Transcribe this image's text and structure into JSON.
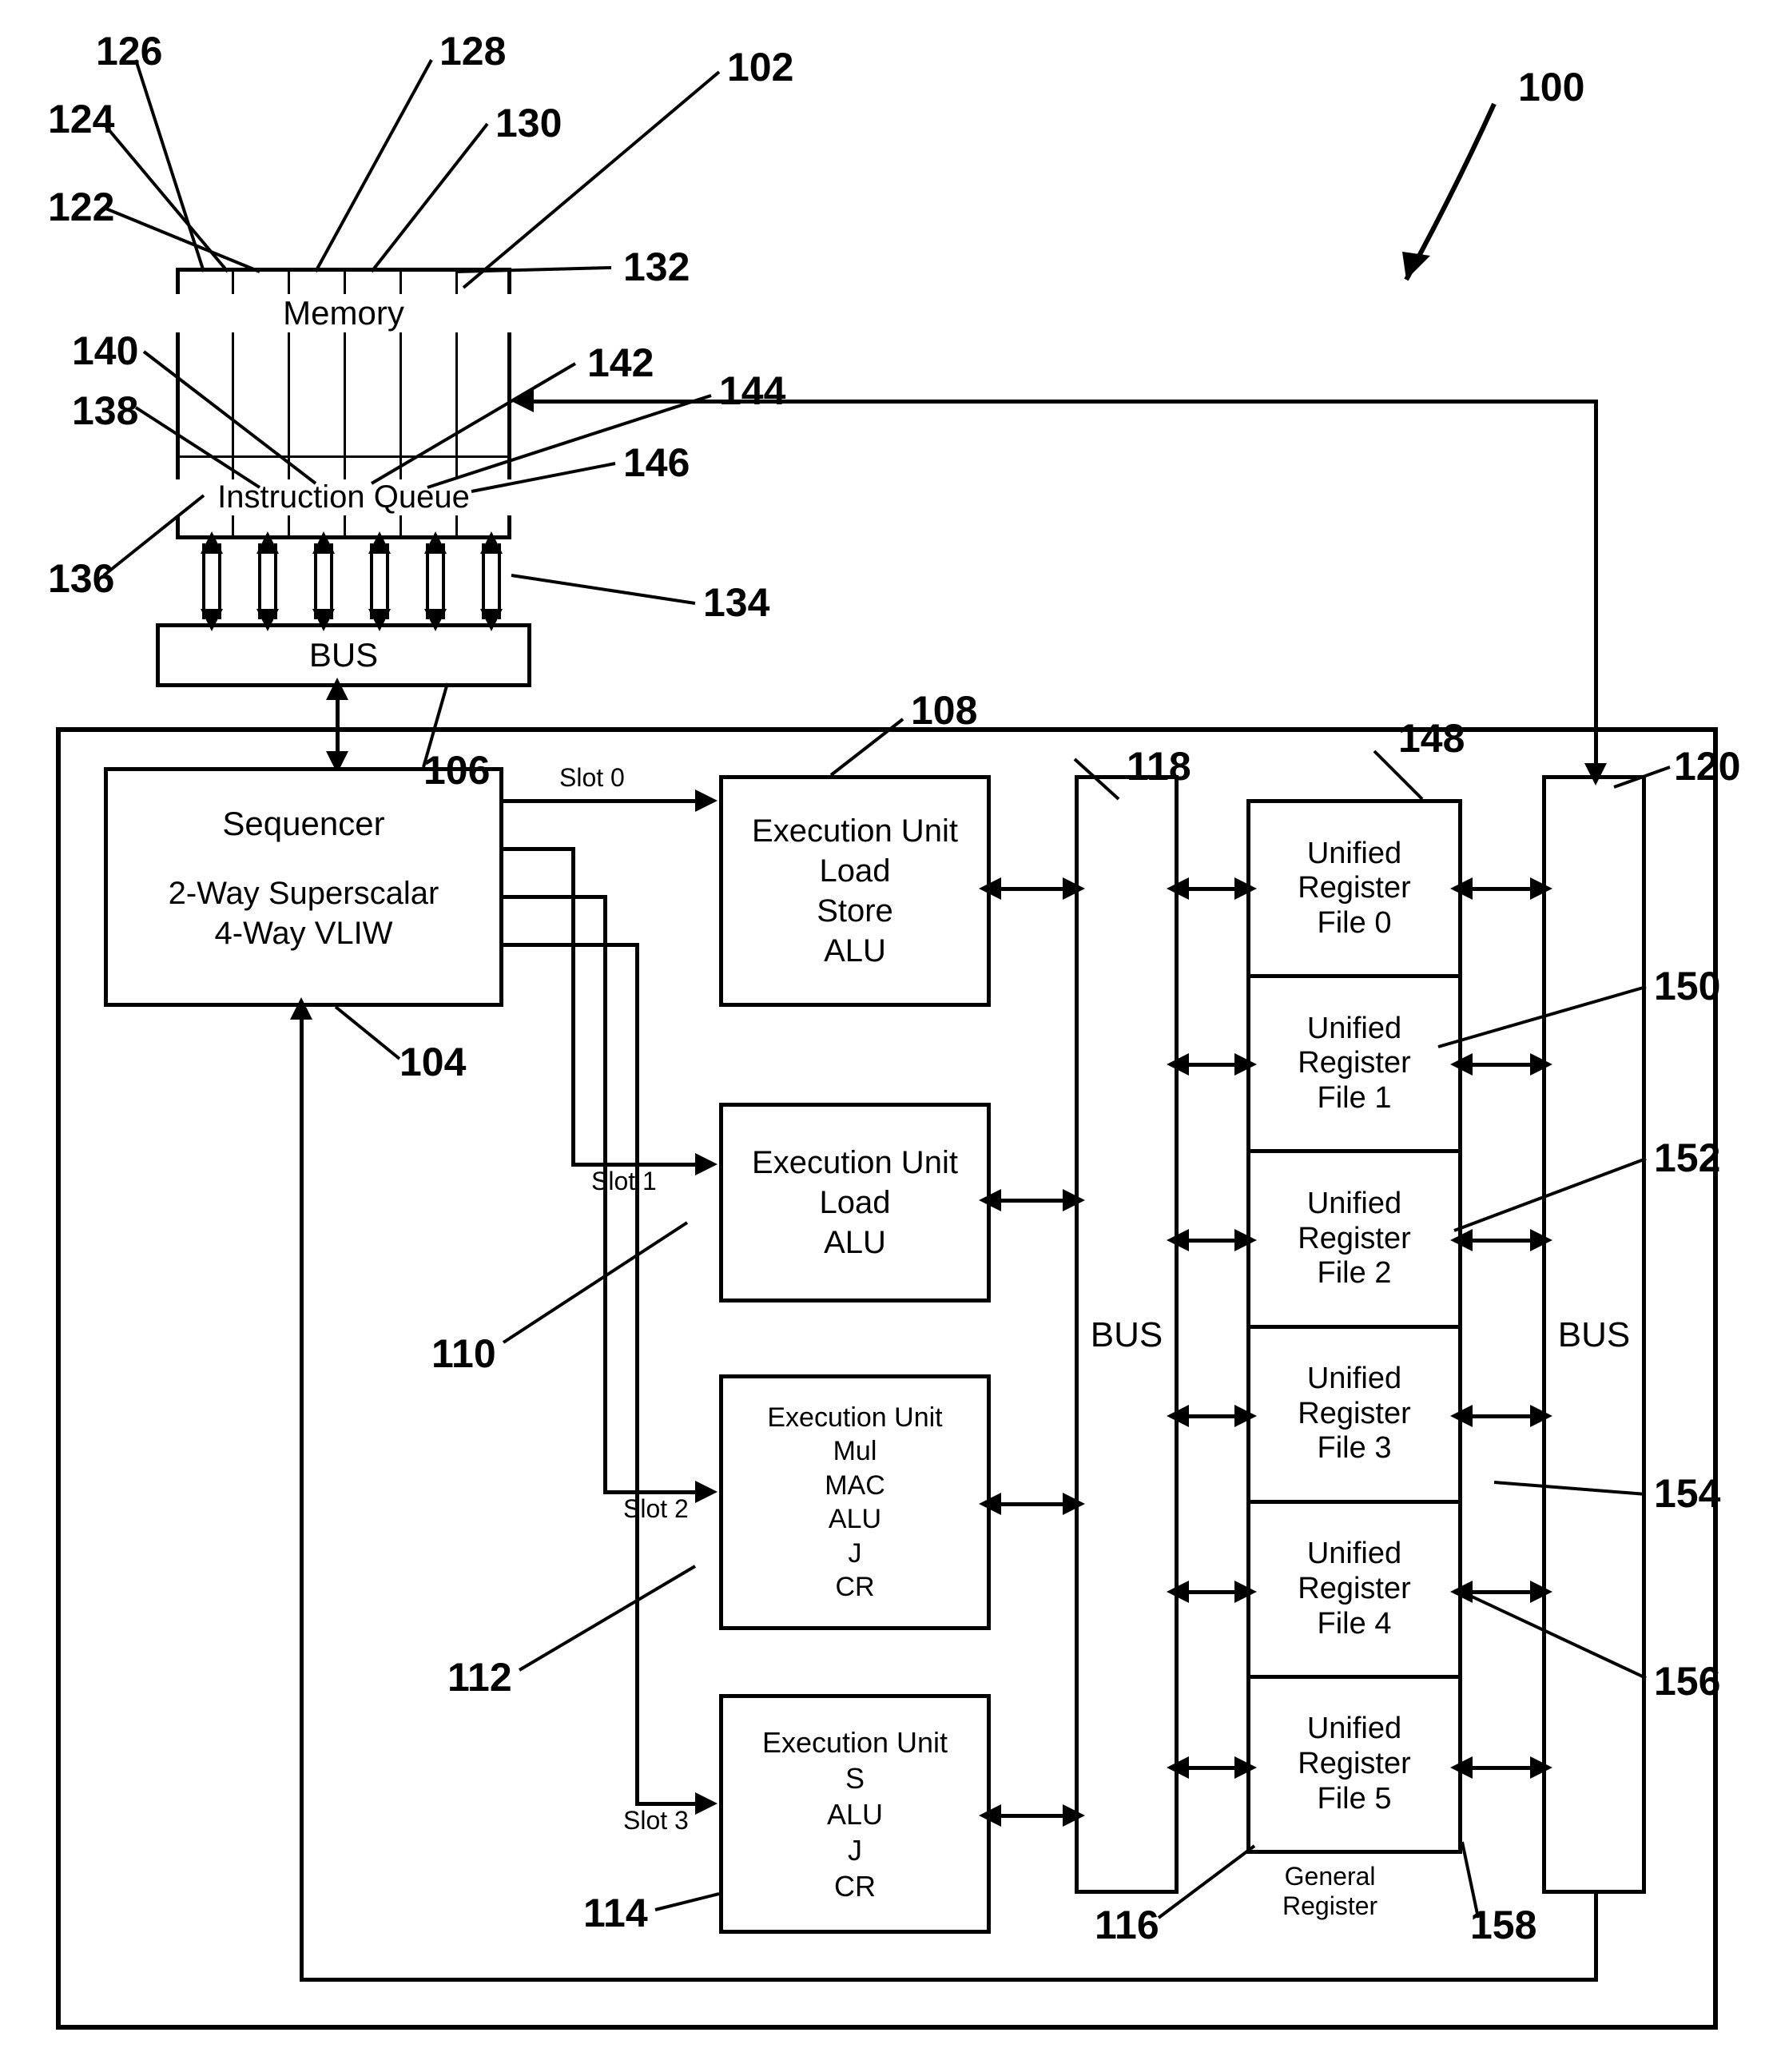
{
  "system_ref": "100",
  "memory": {
    "title": "Memory",
    "queue_label": "Instruction Queue",
    "ref": "102",
    "queue_ref": "134",
    "col_refs": [
      "122",
      "124",
      "126",
      "128",
      "130",
      "132"
    ],
    "queue_cell_refs": [
      "136",
      "138",
      "140",
      "142",
      "144",
      "146"
    ]
  },
  "bus_top": {
    "label": "BUS",
    "ref": "106"
  },
  "sequencer": {
    "title": "Sequencer",
    "line1": "2-Way Superscalar",
    "line2": "4-Way VLIW",
    "ref": "104"
  },
  "slots": {
    "s0": "Slot 0",
    "s1": "Slot 1",
    "s2": "Slot 2",
    "s3": "Slot 3"
  },
  "exec": {
    "u0": {
      "l0": "Execution Unit",
      "l1": "Load",
      "l2": "Store",
      "l3": "ALU",
      "ref": "108"
    },
    "u1": {
      "l0": "Execution Unit",
      "l1": "Load",
      "l2": "ALU",
      "ref": "110"
    },
    "u2": {
      "l0": "Execution Unit",
      "l1": "Mul",
      "l2": "MAC",
      "l3": "ALU",
      "l4": "J",
      "l5": "CR",
      "ref": "112"
    },
    "u3": {
      "l0": "Execution Unit",
      "l1": "S",
      "l2": "ALU",
      "l3": "J",
      "l4": "CR",
      "ref": "114"
    }
  },
  "bus_mid": {
    "label": "BUS",
    "ref": "118"
  },
  "bus_right": {
    "label": "BUS",
    "ref": "120"
  },
  "registers": {
    "title": "General\nRegister",
    "ref": "116",
    "cells": [
      {
        "l0": "Unified",
        "l1": "Register",
        "l2": "File 0",
        "ref": "148"
      },
      {
        "l0": "Unified",
        "l1": "Register",
        "l2": "File 1",
        "ref": "150"
      },
      {
        "l0": "Unified",
        "l1": "Register",
        "l2": "File 2",
        "ref": "152"
      },
      {
        "l0": "Unified",
        "l1": "Register",
        "l2": "File 3",
        "ref": "154"
      },
      {
        "l0": "Unified",
        "l1": "Register",
        "l2": "File 4",
        "ref": "156"
      },
      {
        "l0": "Unified",
        "l1": "Register",
        "l2": "File 5",
        "ref": "158"
      }
    ]
  }
}
